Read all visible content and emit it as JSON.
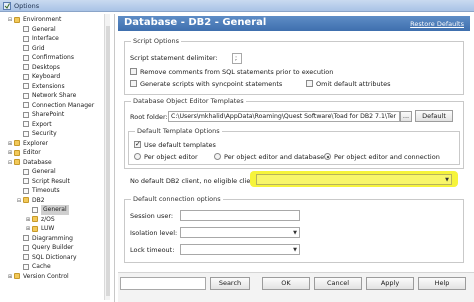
{
  "window": {
    "title": "Options"
  },
  "tree": {
    "items": [
      {
        "label": "Environment",
        "level": 0,
        "expander": "⊟",
        "folder": true
      },
      {
        "label": "General",
        "level": 1
      },
      {
        "label": "Interface",
        "level": 1
      },
      {
        "label": "Grid",
        "level": 1
      },
      {
        "label": "Confirmations",
        "level": 1
      },
      {
        "label": "Desktops",
        "level": 1
      },
      {
        "label": "Keyboard",
        "level": 1
      },
      {
        "label": "Extensions",
        "level": 1
      },
      {
        "label": "Network Share",
        "level": 1
      },
      {
        "label": "Connection Manager",
        "level": 1
      },
      {
        "label": "SharePoint",
        "level": 1
      },
      {
        "label": "Export",
        "level": 1
      },
      {
        "label": "Security",
        "level": 1
      },
      {
        "label": "Explorer",
        "level": 0,
        "expander": "⊞",
        "folder": true
      },
      {
        "label": "Editor",
        "level": 0,
        "expander": "⊞",
        "folder": true
      },
      {
        "label": "Database",
        "level": 0,
        "expander": "⊟",
        "folder": true
      },
      {
        "label": "General",
        "level": 1
      },
      {
        "label": "Script Result",
        "level": 1
      },
      {
        "label": "Timeouts",
        "level": 1
      },
      {
        "label": "DB2",
        "level": 1,
        "expander": "⊟",
        "folder": true
      },
      {
        "label": "General",
        "level": 2,
        "selected": true
      },
      {
        "label": "z/OS",
        "level": 2,
        "expander": "⊞",
        "folder": true
      },
      {
        "label": "LUW",
        "level": 2,
        "expander": "⊞",
        "folder": true
      },
      {
        "label": "Diagramming",
        "level": 1
      },
      {
        "label": "Query Builder",
        "level": 1
      },
      {
        "label": "SQL Dictionary",
        "level": 1
      },
      {
        "label": "Cache",
        "level": 1
      },
      {
        "label": "Version Control",
        "level": 0,
        "expander": "⊞",
        "folder": true
      }
    ]
  },
  "header": {
    "title": "Database - DB2 - General",
    "restore_link": "Restore Defaults"
  },
  "script_options": {
    "group_title": "Script Options",
    "delimiter_label": "Script statement delimiter:",
    "delimiter_value": ";",
    "remove_comments": "Remove comments from SQL statements prior to execution",
    "generate_scripts": "Generate scripts with syncpoint statements",
    "omit_defaults": "Omit default attributes"
  },
  "editor_templates": {
    "group_title": "Database Object Editor Templates",
    "root_folder_label": "Root folder:",
    "root_folder_value": "C:\\Users\\mkhalid\\AppData\\Roaming\\Quest Software\\Toad for DB2 7.1\\Ter",
    "ellipsis": "...",
    "default_button": "Default",
    "default_template_group": "Default Template Options",
    "use_default": "Use default templates",
    "radio_options": [
      "Per object editor",
      "Per object editor and database",
      "Per object editor and connection"
    ],
    "selected_radio": 2
  },
  "default_client": {
    "label": "No default DB2 client, no eligible clients:",
    "value": ""
  },
  "default_connection": {
    "group_title": "Default connection options",
    "session_user_label": "Session user:",
    "isolation_label": "Isolation level:",
    "lock_timeout_label": "Lock timeout:"
  },
  "bottom": {
    "search_placeholder": "",
    "search_button": "Search",
    "ok_button": "OK",
    "cancel_button": "Cancel",
    "apply_button": "Apply",
    "help_button": "Help"
  },
  "colors": {
    "header_blue": "#4a79b8",
    "highlight_yellow": "#f6f43a",
    "folder_yellow": "#f2c95a"
  }
}
